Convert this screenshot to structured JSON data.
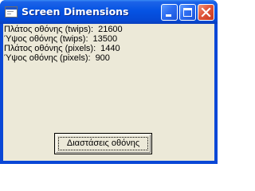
{
  "window": {
    "title": "Screen Dimensions",
    "icon": "vb-form-icon",
    "buttons": {
      "minimize": "minimize-icon",
      "maximize": "maximize-icon",
      "close": "close-icon"
    }
  },
  "info": [
    {
      "label": "Πλάτος οθόνης (twips):",
      "value": "21600"
    },
    {
      "label": "Ύψος οθόνης (twips):",
      "value": "13500"
    },
    {
      "label": "Πλάτος οθόνης (pixels):",
      "value": "1440"
    },
    {
      "label": "Ύψος οθόνης (pixels):",
      "value": "900"
    }
  ],
  "button": {
    "label": "Διαστάσεις οθόνης"
  },
  "colors": {
    "titlebar": "#0553e3",
    "client": "#ece9d8",
    "close_button": "#e0553a"
  }
}
